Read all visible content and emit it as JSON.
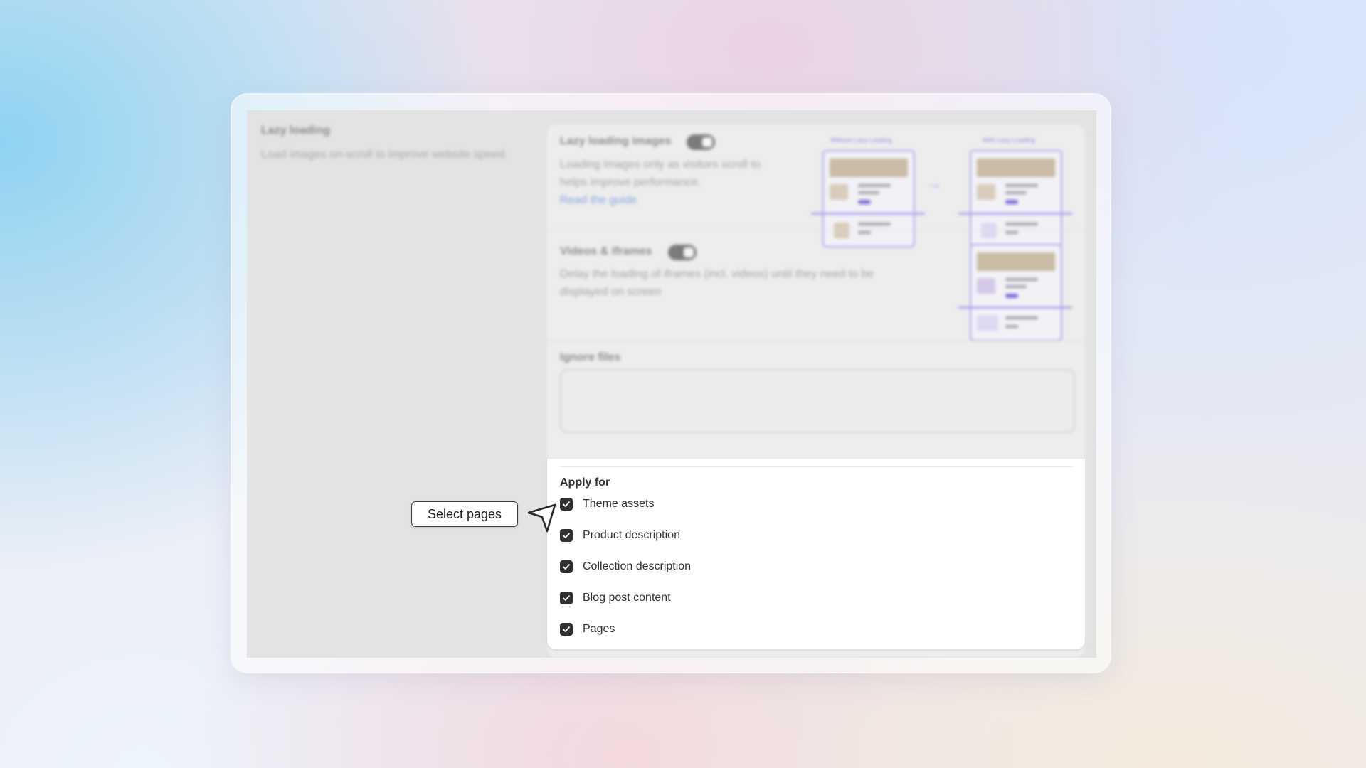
{
  "left_panel": {
    "title": "Lazy loading",
    "description": "Load images on-scroll to improve website speed"
  },
  "lazy_images": {
    "title": "Lazy loading images",
    "toggle_on": true,
    "description_line1": "Loading images only as visitors scroll to",
    "description_line2": "helps improve performance.",
    "guide_link": "Read the guide",
    "illustration": {
      "without_label": "Without Lazy Loading",
      "with_label": "With Lazy Loading",
      "arrow": "→"
    }
  },
  "videos": {
    "title": "Videos & iframes",
    "toggle_on": true,
    "description_line1": "Delay the loading of iframes (incl. videos) until they need to be",
    "description_line2": "displayed on screen"
  },
  "ignore_files": {
    "label": "Ignore files",
    "value": ""
  },
  "apply_for": {
    "title": "Apply for",
    "options": [
      {
        "label": "Theme assets",
        "checked": true
      },
      {
        "label": "Product description",
        "checked": true
      },
      {
        "label": "Collection description",
        "checked": true
      },
      {
        "label": "Blog post content",
        "checked": true
      },
      {
        "label": "Pages",
        "checked": true
      }
    ]
  },
  "callout": {
    "label": "Select pages",
    "icon": "cursor-arrow-icon"
  },
  "colors": {
    "checkbox": "#303030",
    "accent": "#a9a2ee",
    "link": "#8aa1de"
  }
}
